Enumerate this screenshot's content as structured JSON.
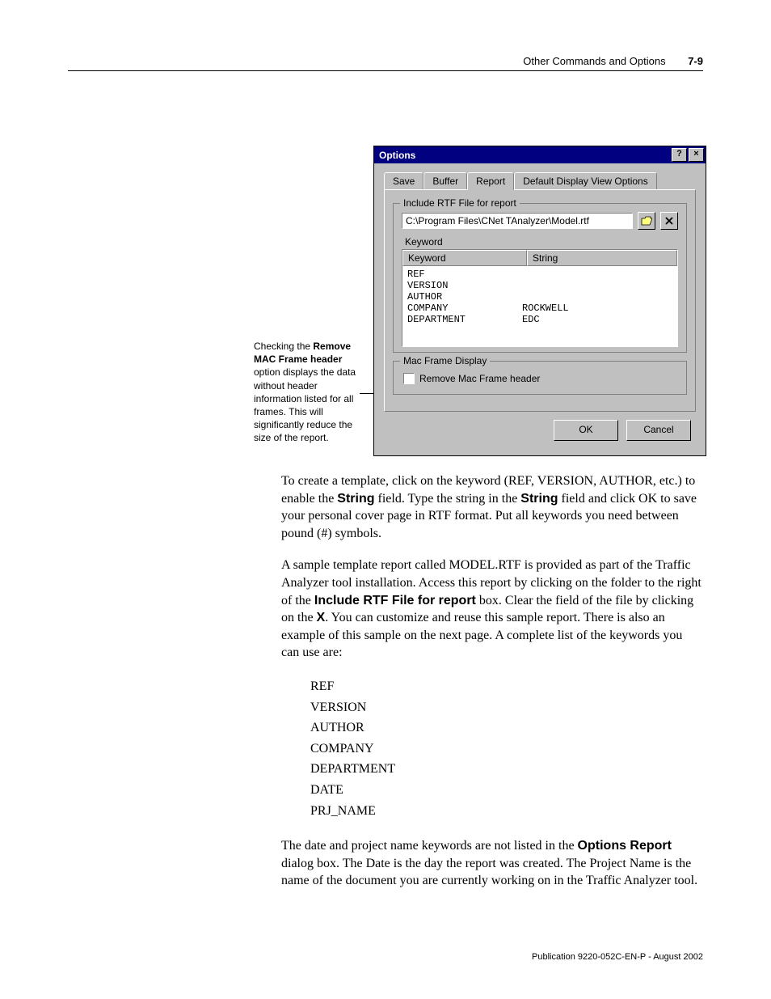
{
  "header": {
    "section": "Other Commands and Options",
    "page": "7-9"
  },
  "callout": {
    "prefix": "Checking the ",
    "bold": "Remove MAC Frame header",
    "rest": " option displays the data without header information listed for all frames. This will significantly reduce the size of the report."
  },
  "dialog": {
    "title": "Options",
    "help_btn": "?",
    "close_btn": "×",
    "tabs": [
      "Save",
      "Buffer",
      "Report",
      "Default Display View Options"
    ],
    "active_tab": "Report",
    "include_group": "Include RTF File for report",
    "path": "C:\\Program Files\\CNet TAnalyzer\\Model.rtf",
    "browse_icon": "folder-open-icon",
    "clear_icon": "close-icon",
    "keyword_label": "Keyword",
    "columns": [
      "Keyword",
      "String"
    ],
    "rows": [
      {
        "keyword": "REF",
        "string": ""
      },
      {
        "keyword": "VERSION",
        "string": ""
      },
      {
        "keyword": "AUTHOR",
        "string": ""
      },
      {
        "keyword": "COMPANY",
        "string": "ROCKWELL"
      },
      {
        "keyword": "DEPARTMENT",
        "string": "EDC"
      }
    ],
    "mac_group": "Mac Frame Display",
    "mac_checkbox": "Remove Mac Frame header",
    "ok": "OK",
    "cancel": "Cancel"
  },
  "body": {
    "p1a": "To create a template, click on the keyword (REF, VERSION, AUTHOR, etc.) to enable the ",
    "p1b": "String",
    "p1c": " field. Type the string in the ",
    "p1d": "String",
    "p1e": " field and click OK to save your personal cover page in RTF format. Put all keywords you need between pound (#) symbols.",
    "p2a": "A sample template report called MODEL.RTF is provided as part of the Traffic Analyzer tool installation. Access this report by clicking on the folder to the right of the ",
    "p2b": "Include RTF File for report",
    "p2c": " box. Clear the field of the file by clicking on the ",
    "p2d": "X",
    "p2e": ". You can customize and reuse this sample report. There is also an example of this sample on the next page. A complete list of the keywords you can use are:",
    "keyword_list": [
      "REF",
      "VERSION",
      "AUTHOR",
      "COMPANY",
      "DEPARTMENT",
      "DATE",
      "PRJ_NAME"
    ],
    "p3a": "The date and project name keywords are not listed in the ",
    "p3b": "Options Report",
    "p3c": " dialog box. The Date is the day the report was created. The Project Name is the name of the document you are currently working on in the Traffic Analyzer tool."
  },
  "footer": "Publication 9220-052C-EN-P - August 2002"
}
